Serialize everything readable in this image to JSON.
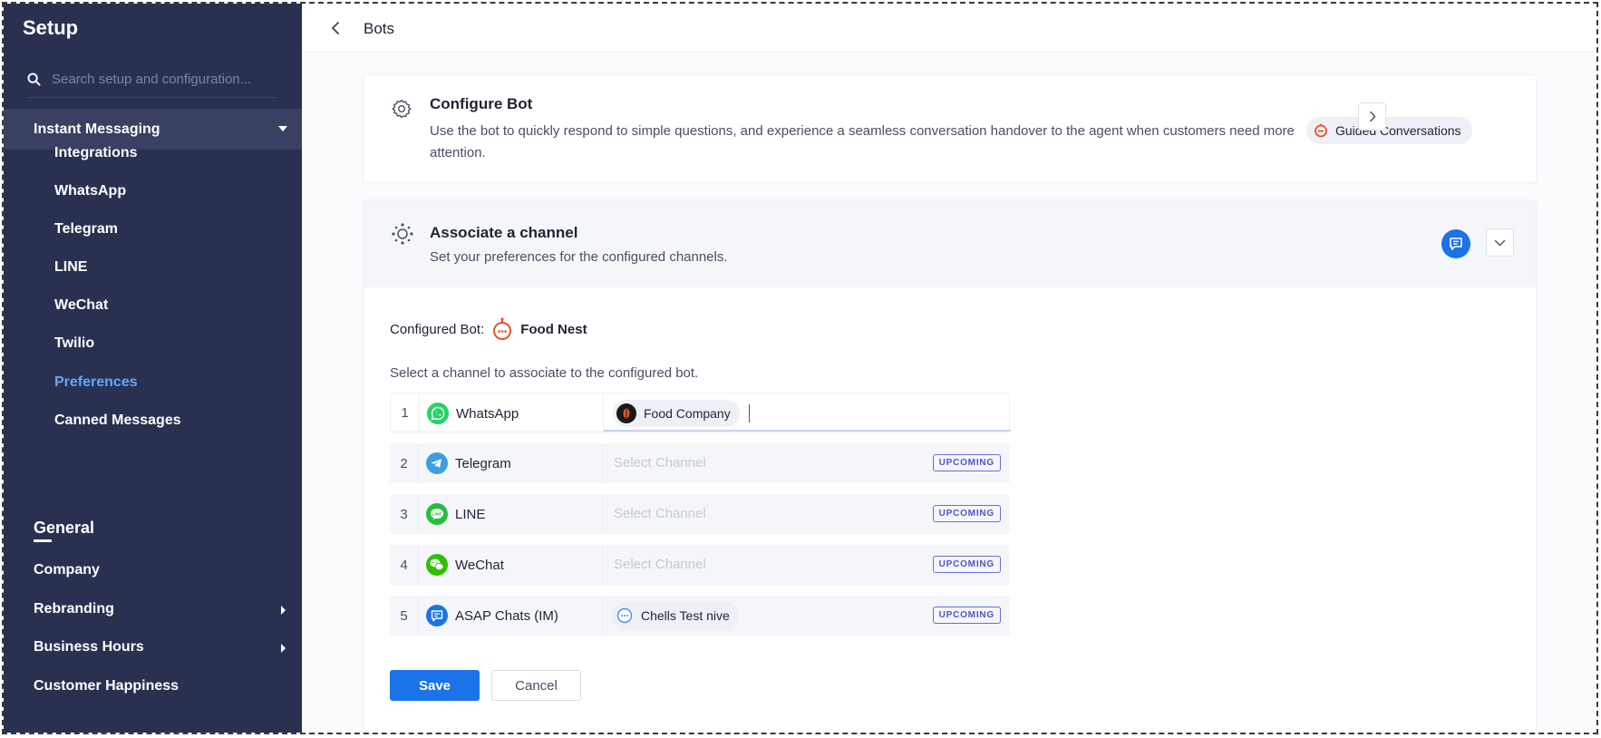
{
  "sidebar": {
    "title": "Setup",
    "search_placeholder": "Search setup and configuration...",
    "section": "Instant Messaging",
    "sub_items": [
      "Integrations",
      "WhatsApp",
      "Telegram",
      "LINE",
      "WeChat",
      "Twilio",
      "Preferences",
      "Canned Messages"
    ],
    "active_sub_item": "Preferences",
    "general_title": "General",
    "general_items": [
      "Company",
      "Rebranding",
      "Business Hours",
      "Customer Happiness"
    ]
  },
  "topbar": {
    "title": "Bots"
  },
  "configure_bot": {
    "title": "Configure Bot",
    "description": "Use the bot to quickly respond to simple questions, and experience a seamless conversation handover to the agent when customers need more attention.",
    "chip_label": "Guided Conversations"
  },
  "associate": {
    "title": "Associate a channel",
    "description": "Set your preferences for the configured channels.",
    "configured_bot_label": "Configured Bot:",
    "configured_bot_name": "Food Nest",
    "select_label": "Select a channel to associate to the configured bot.",
    "placeholder": "Select Channel",
    "upcoming_label": "UPCOMING",
    "rows": [
      {
        "num": "1",
        "app": "WhatsApp",
        "chip": "Food Company"
      },
      {
        "num": "2",
        "app": "Telegram"
      },
      {
        "num": "3",
        "app": "LINE"
      },
      {
        "num": "4",
        "app": "WeChat"
      },
      {
        "num": "5",
        "app": "ASAP Chats (IM)",
        "chip": "Chells Test nive"
      }
    ]
  },
  "actions": {
    "save": "Save",
    "cancel": "Cancel"
  },
  "colors": {
    "sidebar_bg": "#2a3150",
    "sidebar_section_bg": "#394062",
    "active_link": "#5fa8ff",
    "primary": "#1a73e8",
    "whatsapp": "#25d366",
    "telegram": "#3e9fe0",
    "line": "#22c03c",
    "wechat": "#2dc100",
    "upcoming": "#4f54c4"
  }
}
